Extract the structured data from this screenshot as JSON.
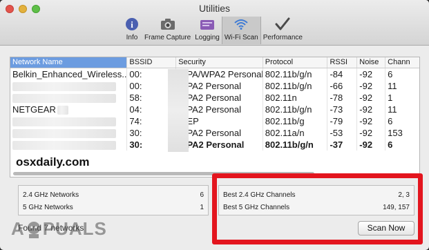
{
  "window": {
    "title": "Utilities"
  },
  "toolbar": {
    "items": [
      {
        "label": "Info",
        "icon": "info-icon"
      },
      {
        "label": "Frame Capture",
        "icon": "camera-icon"
      },
      {
        "label": "Logging",
        "icon": "logging-icon"
      },
      {
        "label": "Wi-Fi Scan",
        "icon": "wifi-icon",
        "selected": true
      },
      {
        "label": "Performance",
        "icon": "performance-icon"
      }
    ]
  },
  "table": {
    "columns": [
      "Network Name",
      "BSSID",
      "Security",
      "Protocol",
      "RSSI",
      "Noise",
      "Chann"
    ],
    "rows": [
      {
        "name": "Belkin_Enhanced_Wireless...",
        "bssid": "00:",
        "security": "WPA/WPA2 Personal",
        "protocol": "802.11b/g/n",
        "rssi": "-84",
        "noise": "-92",
        "channel": "6"
      },
      {
        "name": "",
        "bssid": "00:",
        "security": "WPA2 Personal",
        "protocol": "802.11b/g/n",
        "rssi": "-66",
        "noise": "-92",
        "channel": "11"
      },
      {
        "name": "",
        "bssid": "58:",
        "security": "WPA2 Personal",
        "protocol": "802.11n",
        "rssi": "-78",
        "noise": "-92",
        "channel": "1"
      },
      {
        "name": "NETGEAR",
        "bssid": "04:",
        "security": "WPA2 Personal",
        "protocol": "802.11b/g/n",
        "rssi": "-73",
        "noise": "-92",
        "channel": "11"
      },
      {
        "name": "",
        "bssid": "74:",
        "security": "WEP",
        "protocol": "802.11b/g",
        "rssi": "-79",
        "noise": "-92",
        "channel": "6"
      },
      {
        "name": "",
        "bssid": "30:",
        "security": "WPA2 Personal",
        "protocol": "802.11a/n",
        "rssi": "-53",
        "noise": "-92",
        "channel": "153"
      },
      {
        "name": "",
        "bssid": "30:",
        "security": "WPA2 Personal",
        "protocol": "802.11b/g/n",
        "rssi": "-37",
        "noise": "-92",
        "channel": "6",
        "bold": true
      }
    ]
  },
  "watermark": "osxdaily.com",
  "summary": {
    "ghz24_label": "2.4 GHz Networks",
    "ghz24_count": "6",
    "ghz5_label": "5 GHz Networks",
    "ghz5_count": "1"
  },
  "best": {
    "ghz24_label": "Best 2.4 GHz Channels",
    "ghz24_value": "2, 3",
    "ghz5_label": "Best 5 GHz Channels",
    "ghz5_value": "149, 157"
  },
  "status": "Found 7 networks",
  "scan_button": "Scan Now",
  "logo": {
    "left": "A",
    "right": "PUALS"
  },
  "colors": {
    "highlight": "#e3151e",
    "sorted_header": "#6c9ce0"
  }
}
